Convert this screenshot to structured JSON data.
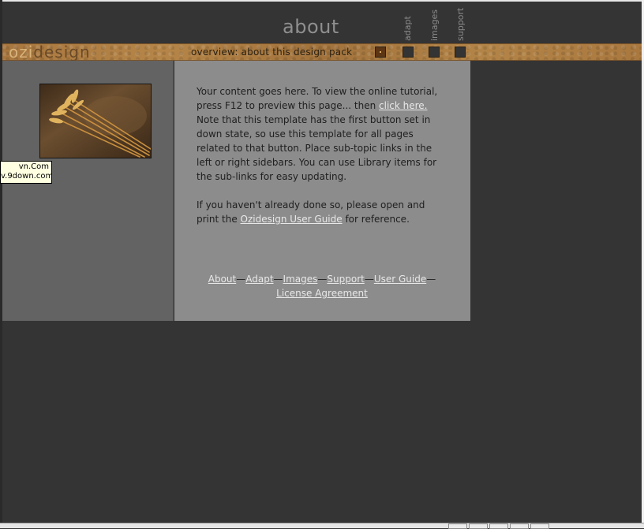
{
  "header": {
    "page_title": "about",
    "tabs": [
      "adapt",
      "images",
      "support"
    ]
  },
  "band": {
    "logo_part1": "ozi",
    "logo_part2": "design",
    "overview": "overview: about this design pack"
  },
  "content": {
    "para1_text": "Your content goes here. To view the online tutorial, press F12 to preview this page... then ",
    "para1_link": "click here.",
    "para1_rest": " Note that this template has the first button set in down state, so use this template for all pages related to that button. Place sub-topic links in the left or right sidebars. You can use Library items for the sub-links for easy updating.",
    "para2_text": "If you haven't already done so, please open and print the ",
    "para2_link": "Ozidesign User Guide",
    "para2_rest": " for reference."
  },
  "footer_links": [
    "About",
    "Adapt",
    "Images",
    "Support",
    "User Guide",
    "License Agreement"
  ],
  "tooltip": {
    "line1": "vn.Com",
    "line2": "v.9down.com/"
  },
  "colors": {
    "background": "#343434",
    "band": "#a8773f",
    "main_panel": "#8c8c8c",
    "sidebar": "#636363",
    "link": "#e8e8e8"
  }
}
